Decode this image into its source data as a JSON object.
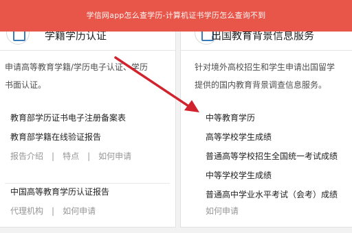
{
  "banner": {
    "title": "学信网app怎么查学历-计算机证书学历怎么查询不到"
  },
  "left": {
    "title": "学籍学历认证",
    "desc": [
      "申请高等教育学籍/学历电子认证、学历",
      "书面认证。"
    ],
    "links": [
      "教育部学历证书电子注册备案表",
      "教育部学籍在线验证报告"
    ],
    "sub1": [
      "报告介绍",
      "特点",
      "如何申请"
    ],
    "link3": "中国高等教育学历认证报告",
    "sub2": [
      "代理机构",
      "如何申请"
    ],
    "separator": "|"
  },
  "right": {
    "title": "出国教育背景信息服务",
    "desc": [
      "针对境外高校招生和学生申请出国留学",
      "提供的国内教育背景调查信息服务。"
    ],
    "links": [
      "中等教育学历",
      "高等学校学生成绩",
      "普通高等学校招生全国统一考试成绩",
      "中等学校学生成绩",
      "普通高中学业水平考试（会考）成绩"
    ],
    "sub": "如何申请"
  },
  "colors": {
    "banner": "#e8564a",
    "arrow": "#d0232e",
    "icon": "#3a7ab8"
  }
}
